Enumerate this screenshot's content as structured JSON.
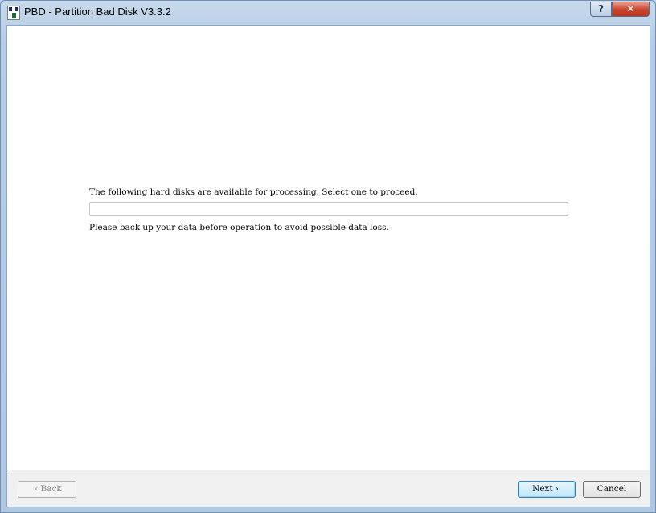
{
  "window": {
    "title": "PBD - Partition Bad Disk V3.3.2",
    "help_glyph": "?",
    "close_glyph": "✕"
  },
  "main": {
    "intro_text": "The following hard disks are available for processing. Select one to proceed.",
    "disk_list_items": [],
    "warning_text": "Please back up your data before operation to avoid possible data loss."
  },
  "footer": {
    "back_label": "Back",
    "back_chevron": "‹",
    "next_label": "Next",
    "next_chevron": "›",
    "cancel_label": "Cancel"
  },
  "colors": {
    "title_bar": "#b7cde5",
    "client_bg": "#f0f0f0",
    "content_bg": "#ffffff",
    "close_button": "#c9452f",
    "default_button_border": "#3c7fb1"
  },
  "icons": [
    "app-icon",
    "help-icon",
    "close-icon",
    "chevron-left-icon",
    "chevron-right-icon"
  ]
}
